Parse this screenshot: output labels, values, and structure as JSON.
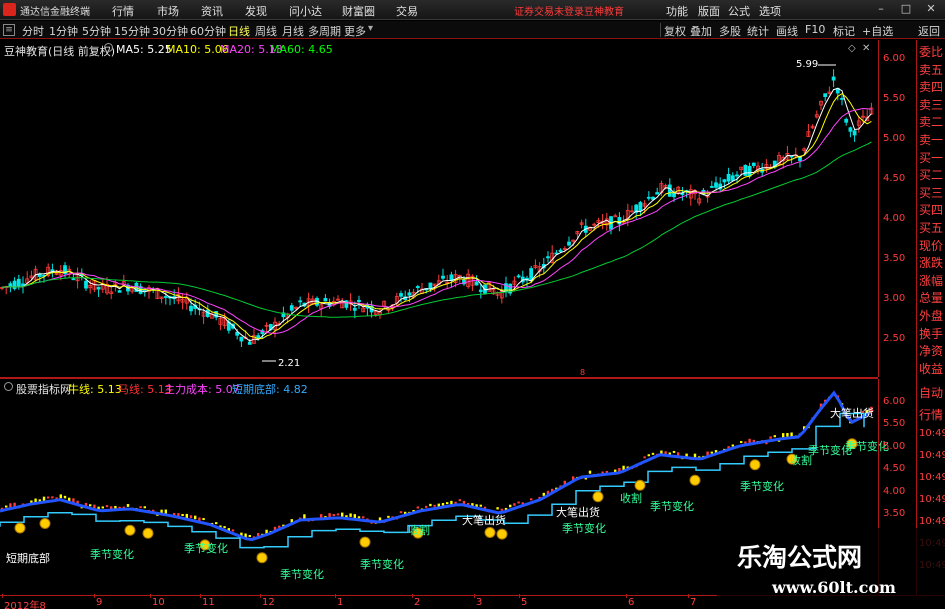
{
  "app": {
    "title": "通达信金融终端"
  },
  "menu": [
    "行情",
    "市场",
    "资讯",
    "发现",
    "问小达",
    "财富圈",
    "交易"
  ],
  "notice": "证券交易未登录",
  "account": "豆神教育",
  "right_menu": [
    "功能",
    "版面",
    "公式",
    "选项"
  ],
  "window_buttons": [
    "minimize-icon",
    "maximize-icon",
    "close-icon"
  ],
  "periods": [
    "分时",
    "1分钟",
    "5分钟",
    "15分钟",
    "30分钟",
    "60分钟",
    "日线",
    "周线",
    "月线",
    "多周期",
    "更多"
  ],
  "active_period": "日线",
  "tools": [
    "复权",
    "叠加",
    "多股",
    "统计",
    "画线",
    "F10",
    "标记",
    "+自选",
    "返回"
  ],
  "main": {
    "stock_label": "豆神教育(日线 前复权)",
    "ma": [
      {
        "label": "MA5: 5.25",
        "color": "#ffffff"
      },
      {
        "label": "MA10: 5.06",
        "color": "#ffff00"
      },
      {
        "label": "MA20: 5.13",
        "color": "#ff44ff"
      },
      {
        "label": "MA60: 4.65",
        "color": "#00ff00"
      }
    ],
    "high_label": "5.99",
    "low_label": "2.21",
    "price_ticks": [
      "6.00",
      "5.50",
      "5.00",
      "4.50",
      "4.00",
      "3.50",
      "3.00",
      "2.50"
    ]
  },
  "indicator": {
    "name": "股票指标网",
    "values": [
      {
        "label": "牛线: 5.13",
        "color": "#ffff00"
      },
      {
        "label": "马线: 5.13",
        "color": "#ff3333"
      },
      {
        "label": "主力成本: 5.07",
        "color": "#ff44ff"
      },
      {
        "label": "短期底部: 4.82",
        "color": "#33aaff"
      }
    ],
    "ticks": [
      "6.00",
      "5.50",
      "5.00",
      "4.50",
      "4.00",
      "3.50"
    ],
    "annotations": [
      {
        "text": "短期底部",
        "color": "#ffffff"
      },
      {
        "text": "季节变化",
        "color": "#33ff99"
      },
      {
        "text": "季节变化",
        "color": "#33ff99"
      },
      {
        "text": "季节变化",
        "color": "#33ff99"
      },
      {
        "text": "季节变化",
        "color": "#33ff99"
      },
      {
        "text": "收割",
        "color": "#33ff99"
      },
      {
        "text": "大笔出货",
        "color": "#ffffff"
      },
      {
        "text": "大笔出货",
        "color": "#ffffff"
      },
      {
        "text": "季节变化",
        "color": "#33ff99"
      },
      {
        "text": "收割",
        "color": "#33ff99"
      },
      {
        "text": "季节变化",
        "color": "#33ff99"
      },
      {
        "text": "季节变化",
        "color": "#33ff99"
      },
      {
        "text": "收割",
        "color": "#33ff99"
      },
      {
        "text": "季节变化",
        "color": "#33ff99"
      },
      {
        "text": "大笔出货",
        "color": "#ffffff"
      },
      {
        "text": "季节变化",
        "color": "#33ff99"
      }
    ]
  },
  "sidebar": [
    "委比",
    "卖五",
    "卖四",
    "卖三",
    "卖二",
    "卖一",
    "买一",
    "买二",
    "买三",
    "买四",
    "买五",
    "现价",
    "涨跌",
    "涨幅",
    "总量",
    "外盘",
    "换手",
    "净资",
    "收益"
  ],
  "sidebar2": [
    "自动",
    "行情",
    "10:49",
    "10:49",
    "10:49",
    "10:49",
    "10:49",
    "10:49",
    "10:49"
  ],
  "xaxis": [
    "2012年8",
    "9",
    "10",
    "11",
    "12",
    "1",
    "2",
    "3",
    "5",
    "6",
    "7"
  ],
  "watermark": {
    "title": "乐淘公式网",
    "url": "www.60lt.com"
  }
}
